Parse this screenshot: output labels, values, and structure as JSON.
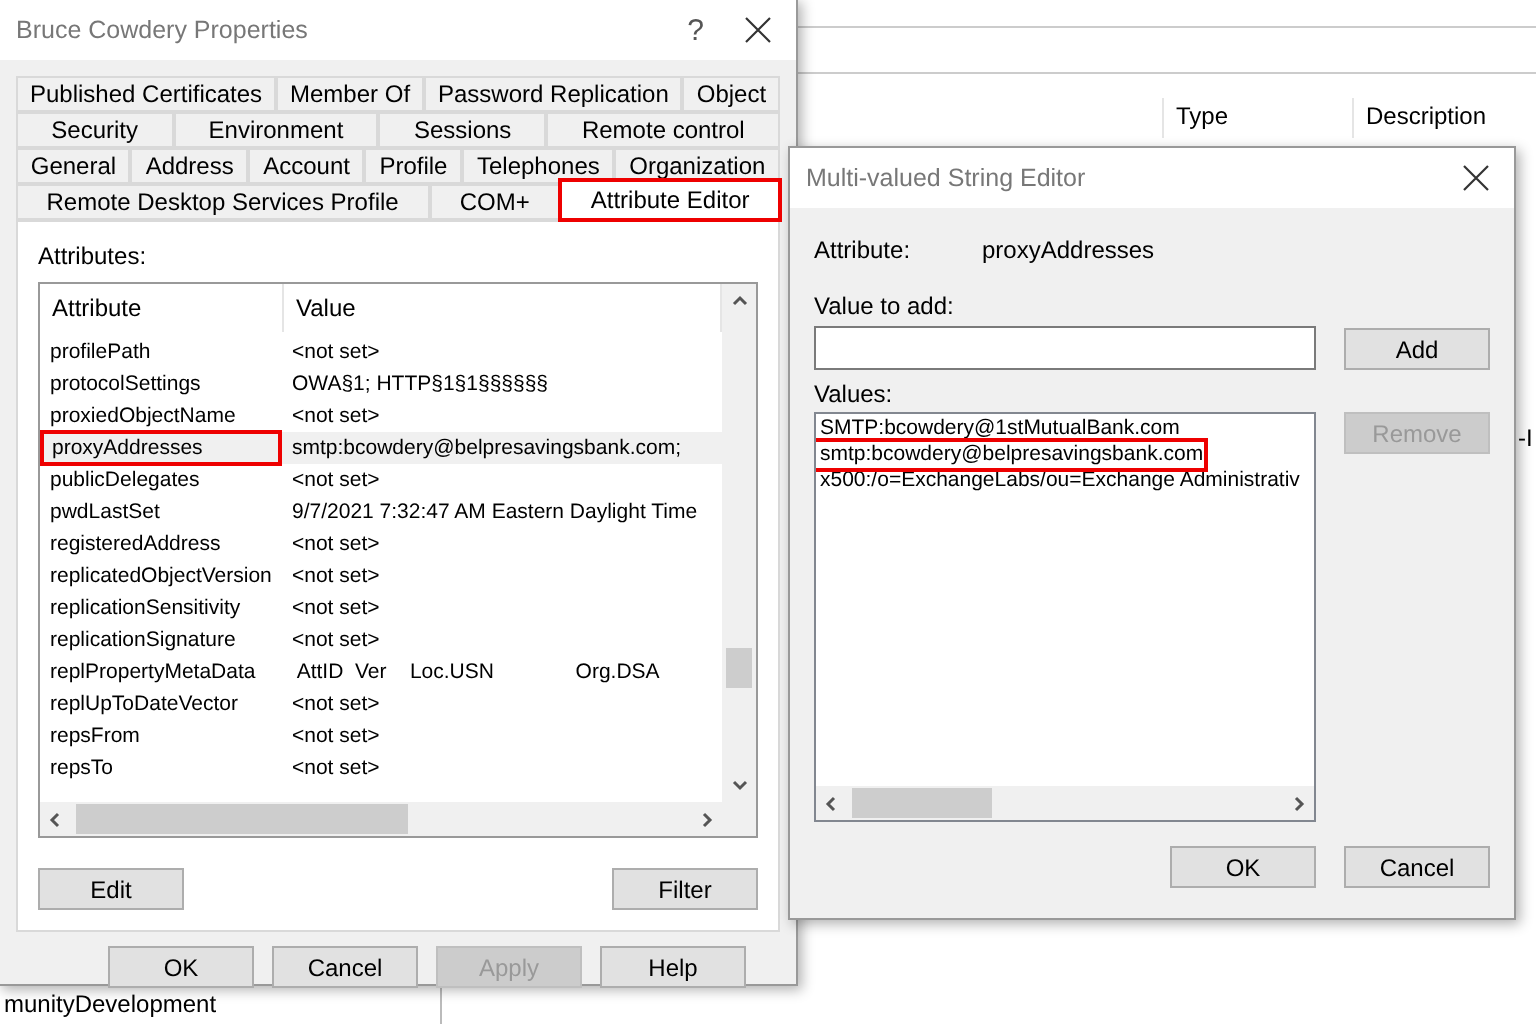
{
  "background_window": {
    "columns": [
      {
        "label": "Type"
      },
      {
        "label": "Description"
      }
    ],
    "fragments": [
      "-I",
      "munityDevelopment"
    ]
  },
  "properties_dialog": {
    "title": "Bruce Cowdery Properties",
    "help_glyph": "?",
    "tab_rows": [
      [
        {
          "label": "Published Certificates",
          "selected": false,
          "highlighted": false
        },
        {
          "label": "Member Of",
          "selected": false,
          "highlighted": false
        },
        {
          "label": "Password Replication",
          "selected": false,
          "highlighted": false
        },
        {
          "label": "Object",
          "selected": false,
          "highlighted": false
        }
      ],
      [
        {
          "label": "Security",
          "selected": false,
          "highlighted": false
        },
        {
          "label": "Environment",
          "selected": false,
          "highlighted": false
        },
        {
          "label": "Sessions",
          "selected": false,
          "highlighted": false
        },
        {
          "label": "Remote control",
          "selected": false,
          "highlighted": false
        }
      ],
      [
        {
          "label": "General",
          "selected": false,
          "highlighted": false
        },
        {
          "label": "Address",
          "selected": false,
          "highlighted": false
        },
        {
          "label": "Account",
          "selected": false,
          "highlighted": false
        },
        {
          "label": "Profile",
          "selected": false,
          "highlighted": false
        },
        {
          "label": "Telephones",
          "selected": false,
          "highlighted": false
        },
        {
          "label": "Organization",
          "selected": false,
          "highlighted": false
        }
      ],
      [
        {
          "label": "Remote Desktop Services Profile",
          "selected": false,
          "highlighted": false
        },
        {
          "label": "COM+",
          "selected": false,
          "highlighted": false
        },
        {
          "label": "Attribute Editor",
          "selected": true,
          "highlighted": true
        }
      ]
    ],
    "attributes_label": "Attributes:",
    "table": {
      "columns": [
        "Attribute",
        "Value"
      ],
      "rows": [
        {
          "attribute": "profilePath",
          "value": "<not set>",
          "selected": false,
          "highlighted": false
        },
        {
          "attribute": "protocolSettings",
          "value": "OWA§1; HTTP§1§1§§§§§§",
          "selected": false,
          "highlighted": false
        },
        {
          "attribute": "proxiedObjectName",
          "value": "<not set>",
          "selected": false,
          "highlighted": false
        },
        {
          "attribute": "proxyAddresses",
          "value": "smtp:bcowdery@belpresavingsbank.com;",
          "selected": true,
          "highlighted": true
        },
        {
          "attribute": "publicDelegates",
          "value": "<not set>",
          "selected": false,
          "highlighted": false
        },
        {
          "attribute": "pwdLastSet",
          "value": "9/7/2021 7:32:47 AM Eastern Daylight Time",
          "selected": false,
          "highlighted": false
        },
        {
          "attribute": "registeredAddress",
          "value": "<not set>",
          "selected": false,
          "highlighted": false
        },
        {
          "attribute": "replicatedObjectVersion",
          "value": "<not set>",
          "selected": false,
          "highlighted": false
        },
        {
          "attribute": "replicationSensitivity",
          "value": "<not set>",
          "selected": false,
          "highlighted": false
        },
        {
          "attribute": "replicationSignature",
          "value": "<not set>",
          "selected": false,
          "highlighted": false
        },
        {
          "attribute": "replPropertyMetaData",
          "value": " AttID  Ver    Loc.USN              Org.DSA",
          "selected": false,
          "highlighted": false
        },
        {
          "attribute": "replUpToDateVector",
          "value": "<not set>",
          "selected": false,
          "highlighted": false
        },
        {
          "attribute": "repsFrom",
          "value": "<not set>",
          "selected": false,
          "highlighted": false
        },
        {
          "attribute": "repsTo",
          "value": "<not set>",
          "selected": false,
          "highlighted": false
        }
      ]
    },
    "panel_buttons": [
      {
        "label": "Edit"
      },
      {
        "label": "Filter"
      }
    ],
    "buttons": [
      {
        "label": "OK",
        "disabled": false
      },
      {
        "label": "Cancel",
        "disabled": false
      },
      {
        "label": "Apply",
        "disabled": true
      },
      {
        "label": "Help",
        "disabled": false
      }
    ]
  },
  "string_editor": {
    "title": "Multi-valued String Editor",
    "attribute_label": "Attribute:",
    "attribute_value": "proxyAddresses",
    "value_to_add_label": "Value to add:",
    "add_button": {
      "label": "Add",
      "disabled": false
    },
    "values_label": "Values:",
    "values": [
      {
        "text": "SMTP:bcowdery@1stMutualBank.com",
        "highlighted": false
      },
      {
        "text": "smtp:bcowdery@belpresavingsbank.com",
        "highlighted": true
      },
      {
        "text": "x500:/o=ExchangeLabs/ou=Exchange Administrativ",
        "highlighted": false
      }
    ],
    "remove_button": {
      "label": "Remove",
      "disabled": true
    },
    "buttons": [
      {
        "label": "OK",
        "disabled": false
      },
      {
        "label": "Cancel",
        "disabled": false
      }
    ]
  }
}
